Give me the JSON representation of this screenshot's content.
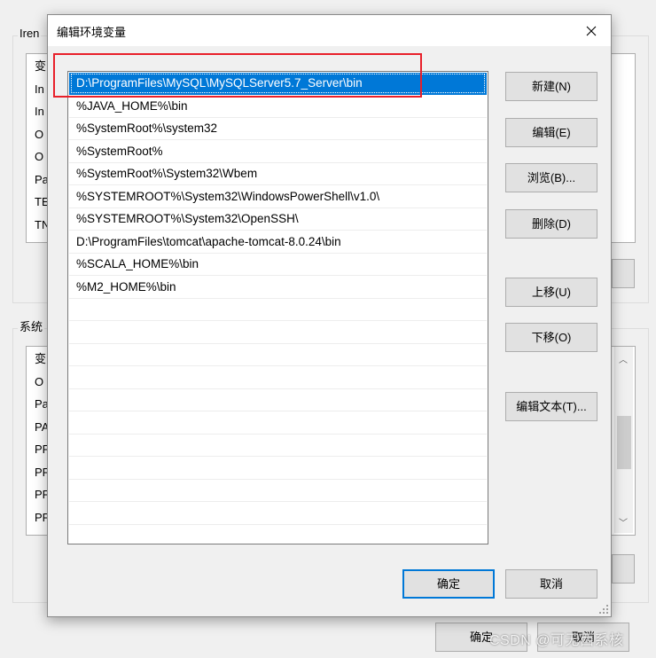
{
  "background_window": {
    "user_group_title": "Iren",
    "user_list_items": [
      "变",
      "In",
      "In",
      "O",
      "O",
      "Pa",
      "TE",
      "TN"
    ],
    "system_group_title": "系统",
    "system_list_items": [
      "变",
      "O",
      "Pa",
      "PA",
      "PF",
      "PF",
      "PF",
      "PF"
    ],
    "ok_label": "确定",
    "cancel_label": "取消"
  },
  "dialog": {
    "title": "编辑环境变量",
    "close_glyph": "✕",
    "paths": [
      "D:\\ProgramFiles\\MySQL\\MySQLServer5.7_Server\\bin",
      "%JAVA_HOME%\\bin",
      "%SystemRoot%\\system32",
      "%SystemRoot%",
      "%SystemRoot%\\System32\\Wbem",
      "%SYSTEMROOT%\\System32\\WindowsPowerShell\\v1.0\\",
      "%SYSTEMROOT%\\System32\\OpenSSH\\",
      "D:\\ProgramFiles\\tomcat\\apache-tomcat-8.0.24\\bin",
      "%SCALA_HOME%\\bin",
      "%M2_HOME%\\bin"
    ],
    "selected_index": 0,
    "buttons": {
      "new": "新建(N)",
      "edit": "编辑(E)",
      "browse": "浏览(B)...",
      "delete": "删除(D)",
      "move_up": "上移(U)",
      "move_down": "下移(O)",
      "edit_text": "编辑文本(T)...",
      "ok": "确定",
      "cancel": "取消"
    }
  },
  "watermark": "CSDN @可无西系核",
  "colors": {
    "selection": "#0078d7",
    "highlight_box": "#e8202a",
    "window_bg": "#f0f0f0"
  }
}
